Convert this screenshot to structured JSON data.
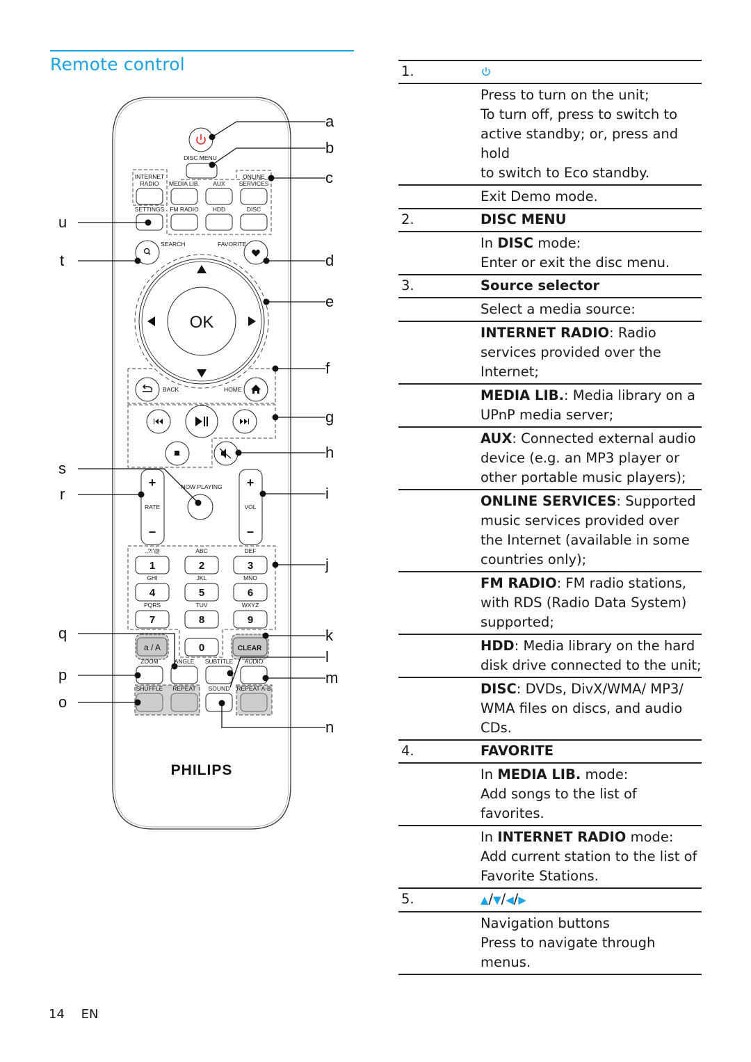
{
  "page": {
    "title": "Remote control",
    "accent_color": "#1ba3e8",
    "page_number": "14",
    "language": "EN"
  },
  "remote": {
    "brand": "PHILIPS",
    "callouts": [
      "a",
      "b",
      "c",
      "d",
      "e",
      "f",
      "g",
      "h",
      "i",
      "j",
      "k",
      "l",
      "m",
      "n",
      "o",
      "p",
      "q",
      "r",
      "s",
      "t",
      "u"
    ],
    "buttons": {
      "power": "power-icon",
      "disc_menu": "DISC MENU",
      "internet_radio_1": "INTERNET",
      "internet_radio_2": "RADIO",
      "media_lib": "MEDIA LIB.",
      "aux": "AUX",
      "online_services_1": "ONLINE",
      "online_services_2": "SERVICES",
      "settings": "SETTINGS",
      "fm_radio": "FM RADIO",
      "hdd": "HDD",
      "disc": "DISC",
      "search": "SEARCH",
      "favorite": "FAVORITE",
      "ok": "OK",
      "back": "BACK",
      "home": "HOME",
      "now_playing": "NOW PLAYING",
      "rate": "RATE",
      "vol": "VOL",
      "plus": "+",
      "minus": "–",
      "keypad": [
        {
          "digit": "1",
          "letters": ".,?!'@"
        },
        {
          "digit": "2",
          "letters": "ABC"
        },
        {
          "digit": "3",
          "letters": "DEF"
        },
        {
          "digit": "4",
          "letters": "GHI"
        },
        {
          "digit": "5",
          "letters": "JKL"
        },
        {
          "digit": "6",
          "letters": "MNO"
        },
        {
          "digit": "7",
          "letters": "PQRS"
        },
        {
          "digit": "8",
          "letters": "TUV"
        },
        {
          "digit": "9",
          "letters": "WXYZ"
        },
        {
          "digit": "0",
          "letters": ""
        }
      ],
      "case_toggle": "a / A",
      "clear": "CLEAR",
      "zoom": "ZOOM",
      "angle": "ANGLE",
      "subtitle": "SUBTITLE",
      "audio": "AUDIO",
      "shuffle": "SHUFFLE",
      "repeat": "REPEAT",
      "sound": "SOUND",
      "repeat_ab": "REPEAT A-B"
    }
  },
  "table": {
    "rows": [
      {
        "num": "1.",
        "head_icon": "power-icon"
      },
      {
        "lines": [
          "Press to turn on the unit;",
          "To turn off, press to switch to",
          "active standby; or, press and hold",
          "to switch to Eco standby."
        ]
      },
      {
        "lines": [
          "Exit Demo mode."
        ]
      },
      {
        "num": "2.",
        "head": "DISC MENU"
      },
      {
        "pre": "In ",
        "bold": "DISC",
        "post": " mode:",
        "lines": [
          "Enter or exit the disc menu."
        ]
      },
      {
        "num": "3.",
        "head": "Source selector"
      },
      {
        "lines": [
          "Select a media source:"
        ]
      },
      {
        "bold": "INTERNET RADIO",
        "post": ": Radio",
        "lines": [
          "services provided over the",
          "Internet;"
        ]
      },
      {
        "bold": "MEDIA LIB.",
        "post": ": Media library on a",
        "lines": [
          "UPnP media server;"
        ]
      },
      {
        "bold": "AUX",
        "post": ": Connected external audio",
        "lines": [
          "device (e.g. an MP3 player or",
          "other portable music players);"
        ]
      },
      {
        "bold": "ONLINE SERVICES",
        "post": ": Supported",
        "lines": [
          "music services provided over",
          "the Internet (available in some",
          "countries only);"
        ]
      },
      {
        "bold": "FM RADIO",
        "post": ": FM radio stations,",
        "lines": [
          "with RDS (Radio Data System)",
          "supported;"
        ]
      },
      {
        "bold": "HDD",
        "post": ": Media library on the hard",
        "lines": [
          "disk drive connected to the unit;"
        ]
      },
      {
        "bold": "DISC",
        "post": ": DVDs, DivX/WMA/ MP3/",
        "lines": [
          "WMA files on discs, and audio",
          "CDs."
        ]
      },
      {
        "num": "4.",
        "head": "FAVORITE"
      },
      {
        "pre": "In ",
        "bold": "MEDIA LIB.",
        "post": " mode:",
        "lines": [
          "Add songs to the list of favorites."
        ]
      },
      {
        "pre": "In ",
        "bold": "INTERNET RADIO",
        "post": " mode:",
        "lines": [
          "Add current station to the list of",
          "Favorite Stations."
        ]
      },
      {
        "num": "5.",
        "head_arrows": [
          "▲",
          "▼",
          "◀",
          "▶"
        ],
        "sep": "/"
      },
      {
        "lines": [
          "Navigation buttons",
          "Press to navigate through menus."
        ]
      }
    ]
  }
}
